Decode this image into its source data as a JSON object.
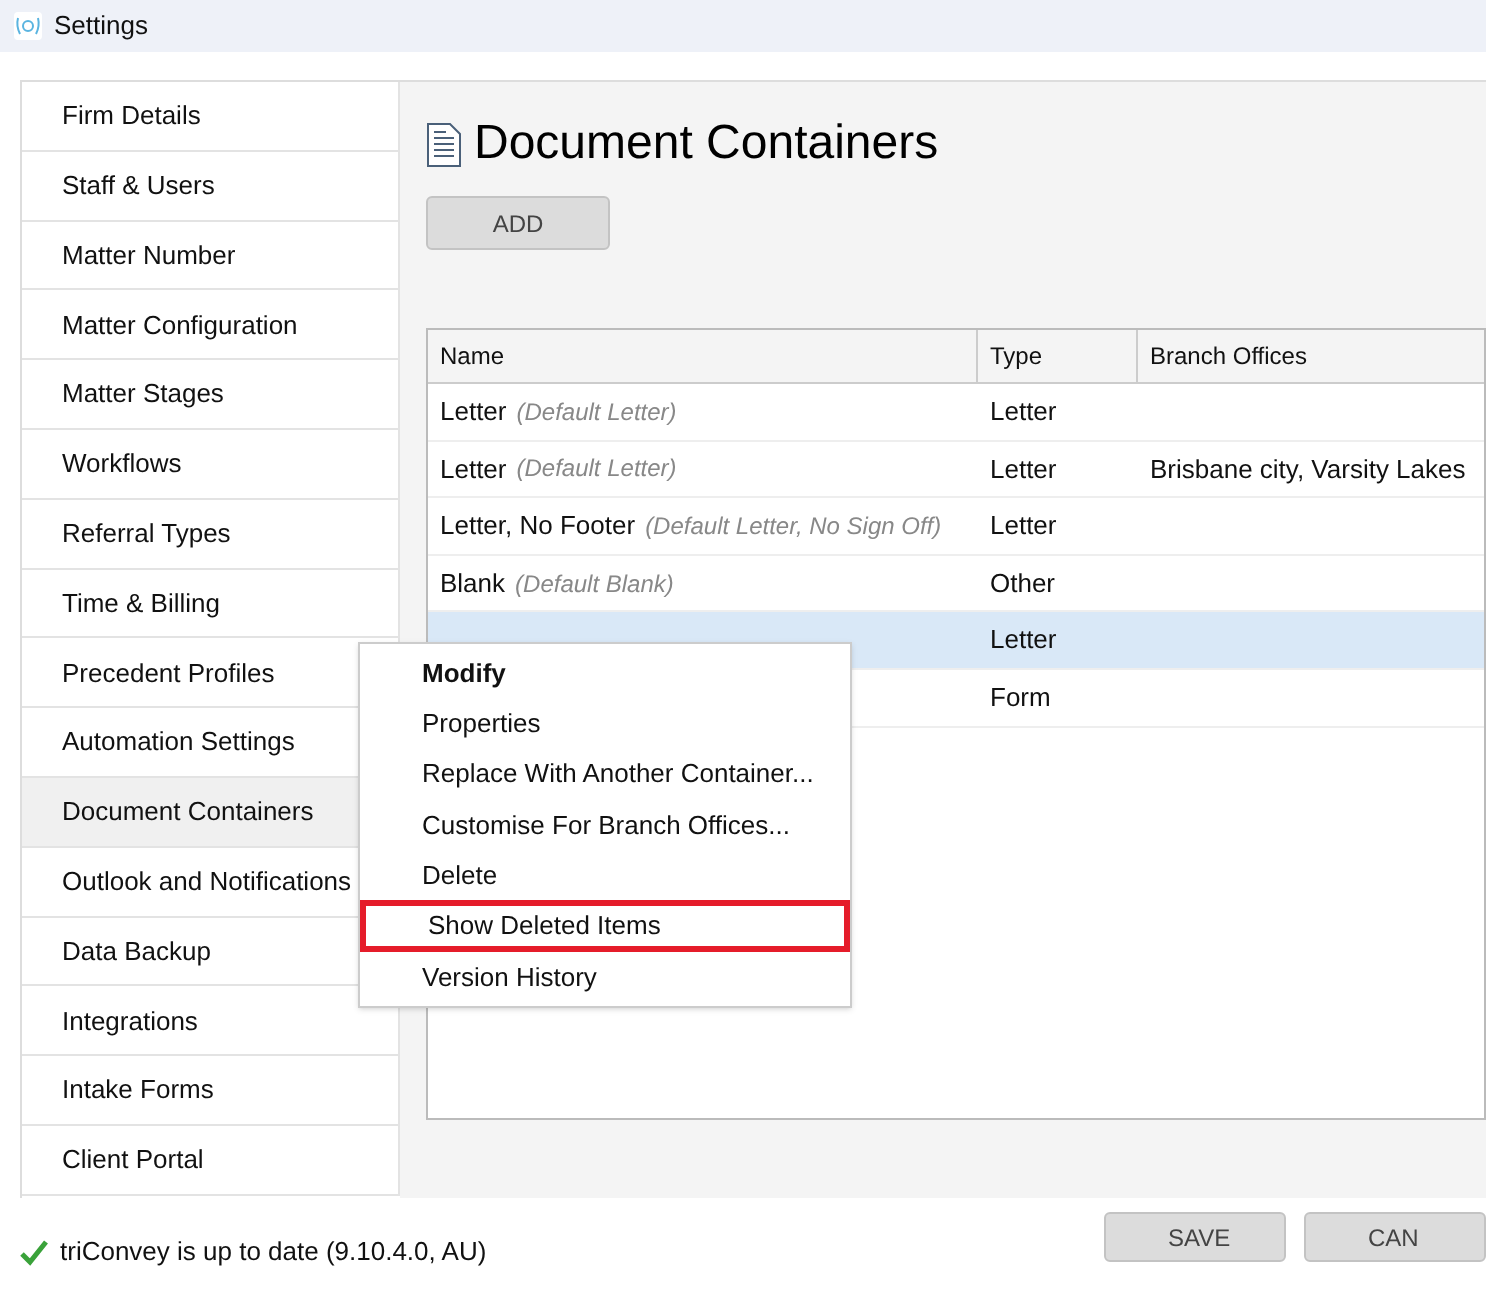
{
  "window": {
    "title": "Settings"
  },
  "sidebar": {
    "items": [
      {
        "label": "Firm Details",
        "selected": false
      },
      {
        "label": "Staff & Users",
        "selected": false
      },
      {
        "label": "Matter Number",
        "selected": false
      },
      {
        "label": "Matter Configuration",
        "selected": false
      },
      {
        "label": "Matter Stages",
        "selected": false
      },
      {
        "label": "Workflows",
        "selected": false
      },
      {
        "label": "Referral Types",
        "selected": false
      },
      {
        "label": "Time & Billing",
        "selected": false
      },
      {
        "label": "Precedent Profiles",
        "selected": false
      },
      {
        "label": "Automation Settings",
        "selected": false
      },
      {
        "label": "Document Containers",
        "selected": true
      },
      {
        "label": "Outlook and Notifications",
        "selected": false
      },
      {
        "label": "Data Backup",
        "selected": false
      },
      {
        "label": "Integrations",
        "selected": false
      },
      {
        "label": "Intake Forms",
        "selected": false
      },
      {
        "label": "Client Portal",
        "selected": false
      }
    ]
  },
  "page": {
    "title": "Document Containers",
    "add_button": "ADD"
  },
  "table": {
    "columns": [
      "Name",
      "Type",
      "Branch Offices"
    ],
    "rows": [
      {
        "name": "Letter",
        "note": "(Default Letter)",
        "type": "Letter",
        "selected": false
      },
      {
        "name": "Letter",
        "note": "(Default Letter)",
        "type": "Letter",
        "branch_offices": "Brisbane city, Varsity Lakes",
        "selected": false
      },
      {
        "name": "Letter, No Footer",
        "note": "(Default Letter, No Sign Off)",
        "type": "Letter",
        "selected": false
      },
      {
        "name": "Blank",
        "note": "(Default Blank)",
        "type": "Other",
        "selected": false
      },
      {
        "type": "Letter",
        "selected": true
      },
      {
        "type": "Form",
        "selected": false
      }
    ]
  },
  "context_menu": {
    "items": [
      {
        "label": "Modify",
        "default": true,
        "highlighted": false
      },
      {
        "label": "Properties",
        "default": false,
        "highlighted": false
      },
      {
        "label": "Replace With Another Container...",
        "default": false,
        "highlighted": false
      },
      {
        "label": "Customise For Branch Offices...",
        "default": false,
        "highlighted": false
      },
      {
        "label": "Delete",
        "default": false,
        "highlighted": false
      },
      {
        "label": "Show Deleted Items",
        "default": false,
        "highlighted": true
      },
      {
        "label": "Version History",
        "default": false,
        "highlighted": false
      }
    ]
  },
  "status": {
    "message": "triConvey is up to date (9.10.4.0, AU)"
  },
  "buttons": [
    "SAVE",
    "CAN"
  ]
}
